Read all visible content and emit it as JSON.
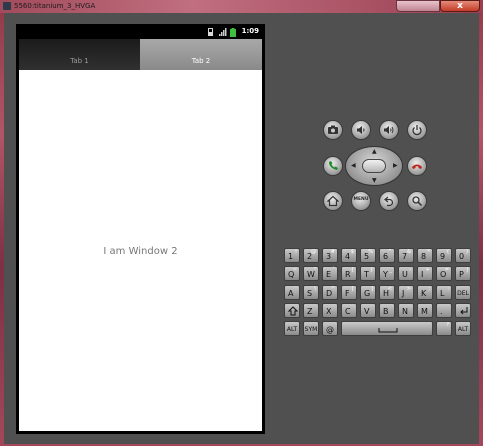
{
  "window": {
    "title": "5560:titanium_3_HVGA",
    "close_label": "x"
  },
  "status_bar": {
    "time": "1:09"
  },
  "tabs": [
    {
      "label": "Tab 1",
      "selected": false
    },
    {
      "label": "Tab 2",
      "selected": true
    }
  ],
  "content": {
    "message": "I am Window 2"
  },
  "controls": {
    "menu_label": "MENU",
    "icons": [
      "camera-icon",
      "volume-down-icon",
      "volume-up-icon",
      "power-icon",
      "call-icon",
      "end-call-icon",
      "home-icon",
      "back-icon",
      "search-icon"
    ]
  },
  "keyboard": {
    "row1": [
      {
        "main": "1",
        "alt": "!"
      },
      {
        "main": "2",
        "alt": "@"
      },
      {
        "main": "3",
        "alt": "#"
      },
      {
        "main": "4",
        "alt": "$"
      },
      {
        "main": "5",
        "alt": "%"
      },
      {
        "main": "6",
        "alt": "^"
      },
      {
        "main": "7",
        "alt": "&"
      },
      {
        "main": "8",
        "alt": "*"
      },
      {
        "main": "9",
        "alt": "("
      },
      {
        "main": "0",
        "alt": ")"
      }
    ],
    "row2": [
      {
        "main": "Q",
        "alt": "~"
      },
      {
        "main": "W",
        "alt": "\""
      },
      {
        "main": "E",
        "alt": "`"
      },
      {
        "main": "R",
        "alt": "{"
      },
      {
        "main": "T",
        "alt": "}"
      },
      {
        "main": "Y",
        "alt": "_"
      },
      {
        "main": "U",
        "alt": "-"
      },
      {
        "main": "I",
        "alt": "+"
      },
      {
        "main": "O",
        "alt": "="
      },
      {
        "main": "P",
        "alt": "|"
      }
    ],
    "row3": [
      {
        "main": "A",
        "alt": "¨"
      },
      {
        "main": "S",
        "alt": "\\"
      },
      {
        "main": "D",
        "alt": "^"
      },
      {
        "main": "F",
        "alt": "["
      },
      {
        "main": "G",
        "alt": "]"
      },
      {
        "main": "H",
        "alt": "<"
      },
      {
        "main": "J",
        "alt": ">"
      },
      {
        "main": "K",
        "alt": ";"
      },
      {
        "main": "L",
        "alt": ":"
      }
    ],
    "del_label": "DEL",
    "row4": [
      {
        "main": "Z",
        "alt": ""
      },
      {
        "main": "X",
        "alt": ""
      },
      {
        "main": "C",
        "alt": ""
      },
      {
        "main": "V",
        "alt": ""
      },
      {
        "main": "B",
        "alt": ""
      },
      {
        "main": "N",
        "alt": ""
      },
      {
        "main": "M",
        "alt": ""
      },
      {
        "main": ".",
        "alt": ""
      }
    ],
    "alt_label": "ALT",
    "sym_label": "SYM",
    "at_label": "@",
    "slash_label": "/",
    "question_label": "?",
    "comma_label": ","
  }
}
